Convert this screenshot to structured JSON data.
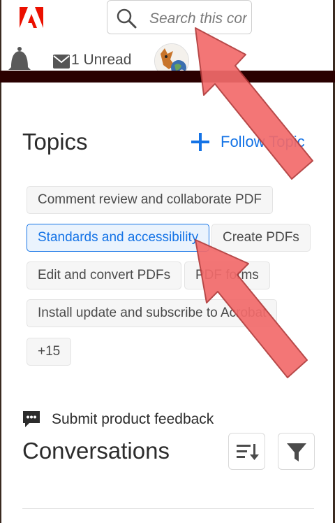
{
  "header": {
    "search_placeholder": "Search this con",
    "unread_label": "1 Unread"
  },
  "topics": {
    "title": "Topics",
    "follow_label": "Follow Topic",
    "chips": [
      "Comment review and collaborate PDF",
      "Standards and accessibility",
      "Create PDFs",
      "Edit and convert PDFs",
      "PDF forms",
      "Install update and subscribe to Acrobat",
      "+15"
    ],
    "active_chip": "Standards and accessibility"
  },
  "feedback": {
    "label": "Submit product feedback"
  },
  "conversations": {
    "title": "Conversations"
  },
  "colors": {
    "accent": "#1473e6",
    "brand_red": "#eb1000",
    "annotation_arrow": "#f26b6b",
    "top_bar": "#2a0000"
  },
  "icons": [
    "adobe-logo-icon",
    "search-icon",
    "bell-icon",
    "mail-icon",
    "plus-icon",
    "feedback-icon",
    "sort-icon",
    "filter-icon"
  ]
}
